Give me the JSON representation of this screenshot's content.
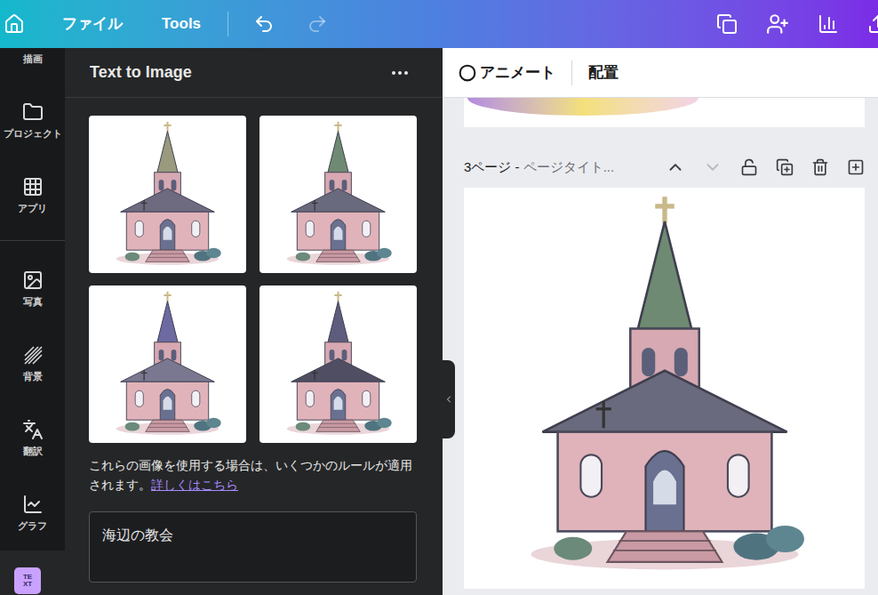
{
  "topbar": {
    "menu": [
      {
        "label": "ファイル"
      },
      {
        "label": "Tools"
      }
    ],
    "undo": {
      "enabled": true
    },
    "redo": {
      "enabled": false
    }
  },
  "rail": {
    "items": [
      {
        "label": "描画"
      },
      {
        "label": "プロジェクト"
      },
      {
        "label": "アプリ"
      },
      {
        "label": "写真"
      },
      {
        "label": "背景"
      },
      {
        "label": "翻訳"
      },
      {
        "label": "グラフ"
      }
    ],
    "active_app": {
      "icon_text": "TEXT"
    }
  },
  "panel": {
    "title": "Text to Image",
    "results": [
      {
        "selected": false
      },
      {
        "selected": false
      },
      {
        "selected": false
      },
      {
        "selected": false
      }
    ],
    "notice": "これらの画像を使用する場合は、いくつかのルールが適用されます。",
    "notice_link": "詳しくはこちら",
    "prompt": "海辺の教会"
  },
  "canvas": {
    "toolbar": [
      {
        "label": "アニメート"
      },
      {
        "label": "配置"
      }
    ],
    "page": {
      "label": "3ページ -",
      "title": "ページタイト...",
      "move_up_enabled": true,
      "move_down_enabled": false
    }
  }
}
